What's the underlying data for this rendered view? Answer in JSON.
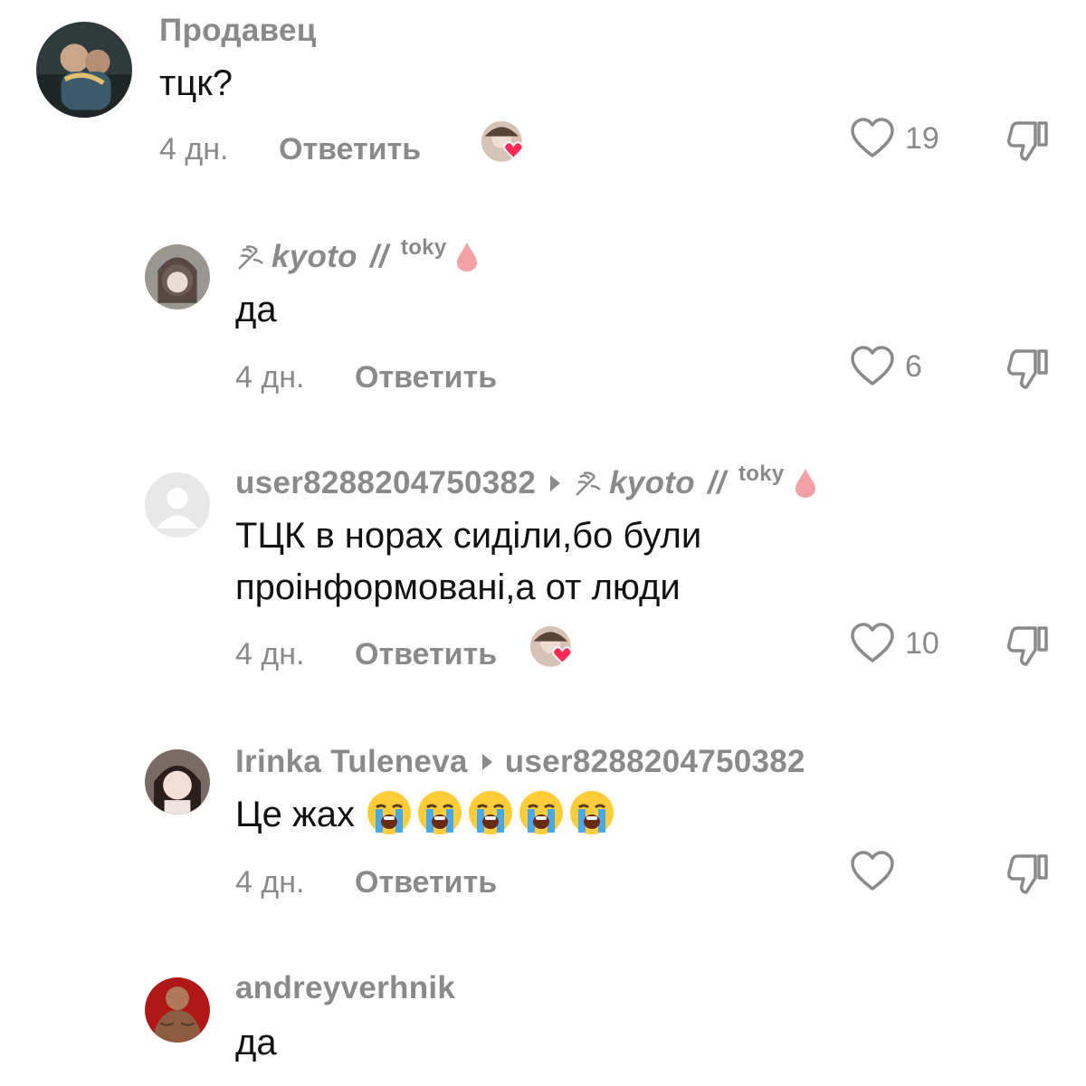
{
  "colors": {
    "meta": "#8a8a8a",
    "text": "#111111",
    "heart_red": "#fe2c55",
    "drop": "#f3a0a6"
  },
  "comments": [
    {
      "username": "Продавец",
      "text_lines": [
        "тцк?"
      ],
      "time": "4 дн.",
      "reply_label": "Ответить",
      "liked_by_creator": true,
      "likes": "19"
    },
    {
      "username_prefix_icon": "feather-icon",
      "username": "kyoto",
      "username_sep": "//",
      "username_sup": "toky",
      "username_suffix_icon": "drop-icon",
      "text_lines": [
        "да"
      ],
      "time": "4 дн.",
      "reply_label": "Ответить",
      "liked_by_creator": false,
      "likes": "6"
    },
    {
      "username": "user8288204750382",
      "reply_to_icon": "feather-icon",
      "reply_to": "kyoto",
      "reply_to_sep": "//",
      "reply_to_sup": "toky",
      "text_lines": [
        "ТЦК в норах сиділи,бо були",
        "проінформовані,а от люди"
      ],
      "time": "4 дн.",
      "reply_label": "Ответить",
      "liked_by_creator": true,
      "likes": "10"
    },
    {
      "username": "Irinka Tuleneva",
      "reply_to": "user8288204750382",
      "text_lines": [
        "Це жах"
      ],
      "emoji": "loudly-crying-face",
      "emoji_count": 5,
      "time": "4 дн.",
      "reply_label": "Ответить",
      "liked_by_creator": false,
      "likes": ""
    },
    {
      "username": "andreyverhnik",
      "text_lines": [
        "да"
      ]
    }
  ]
}
